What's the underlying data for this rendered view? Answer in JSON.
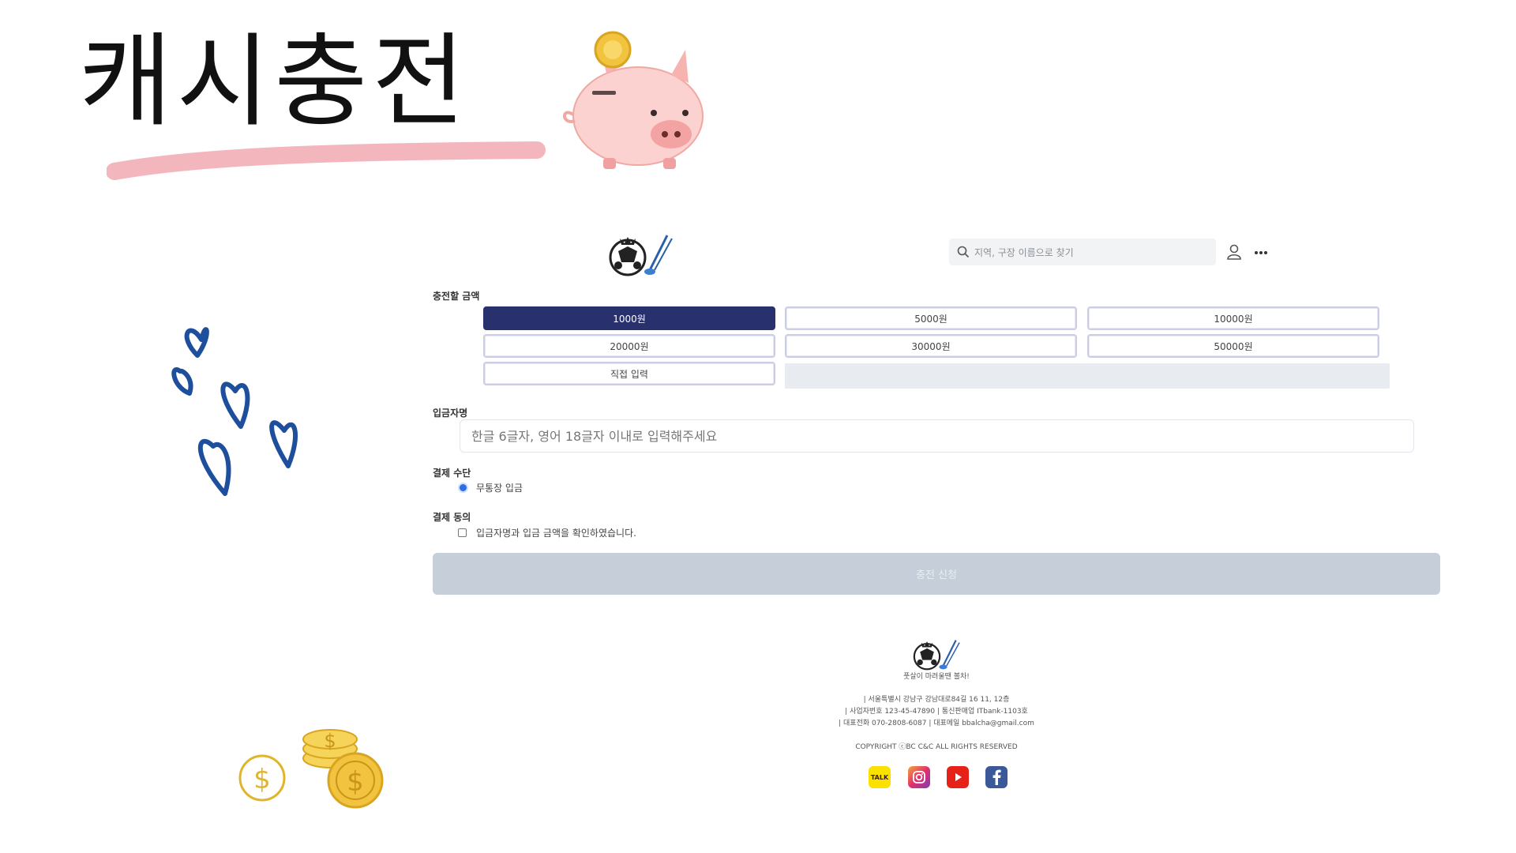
{
  "slide": {
    "title": "캐시충전"
  },
  "header": {
    "search_placeholder": "지역, 구장 이름으로 찾기"
  },
  "charge": {
    "amount_label": "충전할 금액",
    "amounts": [
      "1000원",
      "5000원",
      "10000원",
      "20000원",
      "30000원",
      "50000원"
    ],
    "selected_amount": "1000원",
    "custom_label": "직접 입력"
  },
  "depositor": {
    "label": "입금자명",
    "placeholder": "한글 6글자, 영어 18글자 이내로 입력해주세요"
  },
  "payment": {
    "label": "결제 수단",
    "option": "무통장 입금"
  },
  "agreement": {
    "label": "결제 동의",
    "text": "입금자명과 입금 금액을 확인하였습니다."
  },
  "submit_label": "충전 신청",
  "footer": {
    "tagline": "풋살이 마려울땐 볼차!",
    "address": "| 서울특별시 강남구 강남대로84길 16 11, 12층",
    "business": "| 사업자번호 123-45-47890 | 통신판매업 ITbank-1103호",
    "contact": "| 대표전화 070-2808-6087 | 대표메일 bbalcha@gmail.com",
    "copyright": "COPYRIGHT ⓒBC C&C ALL RIGHTS RESERVED",
    "social_kakao": "TALK"
  },
  "colors": {
    "selected_button": "#28306d",
    "submit_disabled": "#c5ced9",
    "underline_pink": "#f4b6bd",
    "heart_blue": "#1d4f9c",
    "coin_gold": "#e0b52c"
  }
}
